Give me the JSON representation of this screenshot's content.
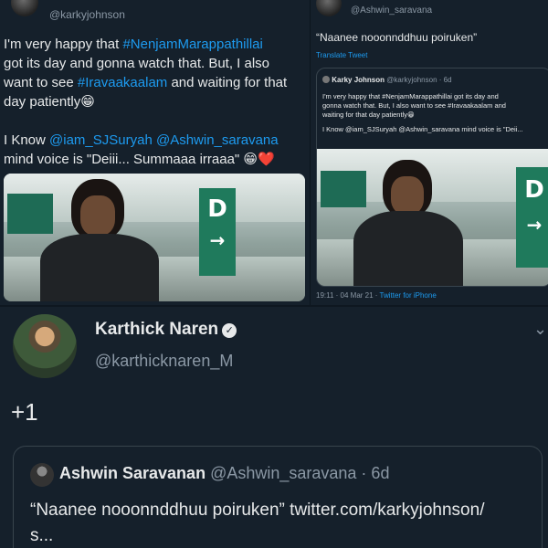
{
  "left_tweet": {
    "handle": "@karkyjohnson",
    "lines": [
      {
        "pre": "I'm very happy that ",
        "hl": "#NenjamMarappathillai",
        "post": ""
      },
      {
        "pre": "got its day and gonna watch that. But, I also",
        "hl": "",
        "post": ""
      },
      {
        "pre": "want to see ",
        "hl": "#Iravaakaalam",
        "post": " and waiting for that"
      },
      {
        "pre": "day patiently😁",
        "hl": "",
        "post": ""
      },
      {
        "pre": "",
        "hl": "",
        "post": ""
      },
      {
        "pre": "I Know ",
        "hl": "@iam_SJSuryah @Ashwin_saravana",
        "post": ""
      },
      {
        "pre": "mind voice is \"Deiii... Summaaa irraaa\" 😁❤️",
        "hl": "",
        "post": ""
      }
    ],
    "media_sign": "D",
    "media_arrow": "→"
  },
  "right_tweet": {
    "handle": "@Ashwin_saravana",
    "quote": "“Naanee nooonnddhuu poiruken”",
    "translate": "Translate Tweet",
    "card": {
      "name": "Karky Johnson",
      "handle_time": "@karkyjohnson · 6d",
      "lines": [
        "I'm very happy that #NenjamMarappathillai got its day and",
        "gonna watch that. But, I also want to see #Iravaakaalam and",
        "waiting for that day patiently😁",
        "",
        "I Know @iam_SJSuryah @Ashwin_saravana mind voice is \"Deii..."
      ],
      "media_sign": "D",
      "media_arrow": "→"
    },
    "meta_time": "19:11 · 04 Mar 21 · ",
    "meta_source": "Twitter for iPhone"
  },
  "bottom_tweet": {
    "name": "Karthick Naren",
    "verified_icon": "✓",
    "handle": "@karthicknaren_M",
    "chevron": "⌄",
    "reply": "+1",
    "quoted": {
      "name": "Ashwin Saravanan",
      "handle_time": "@Ashwin_saravana · 6d",
      "line1": "“Naanee nooonnddhuu poiruken” twitter.com/karkyjohnson/",
      "line2": "s..."
    }
  }
}
